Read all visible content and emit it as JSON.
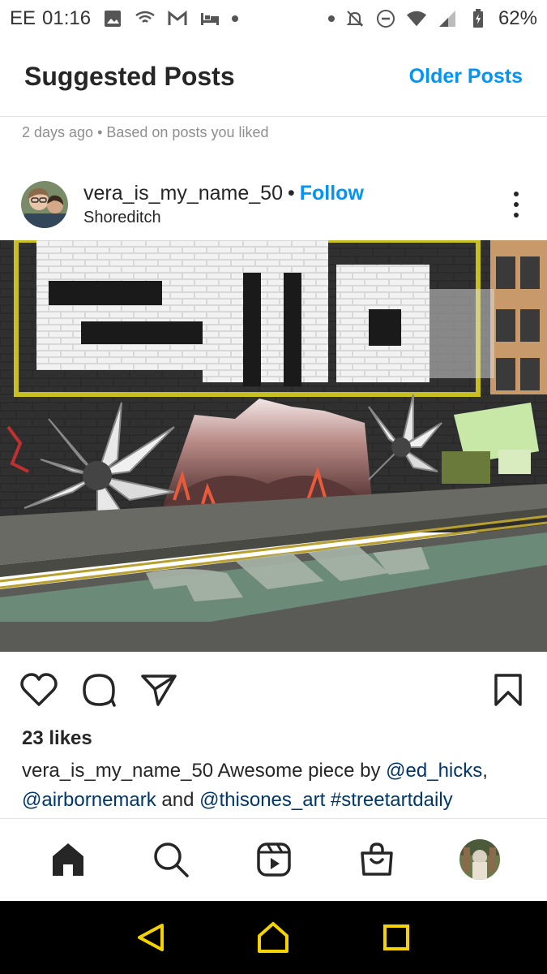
{
  "status_bar": {
    "carrier": "EE",
    "time": "01:16",
    "battery_percent": "62%",
    "left_icons": [
      "image-icon",
      "cast-icon",
      "gmail-icon",
      "bed-icon"
    ],
    "right_icons": [
      "mute-icon",
      "do-not-disturb-icon",
      "wifi-icon",
      "signal-icon",
      "battery-icon"
    ]
  },
  "header": {
    "title": "Suggested Posts",
    "older_link": "Older Posts"
  },
  "subline": "2 days ago • Based on posts you liked",
  "post": {
    "username": "vera_is_my_name_50",
    "separator": "•",
    "follow_label": "Follow",
    "location": "Shoreditch",
    "likes": "23 likes",
    "caption": {
      "user": "vera_is_my_name_50",
      "text1": "Awesome piece by",
      "mention1": "@ed_hicks",
      "comma": ",",
      "mention2": "@airbornemark",
      "text2": "and",
      "mention3": "@thisones_art",
      "hashtag": "#streetartdaily"
    }
  },
  "bottom_nav": [
    "home-icon",
    "search-icon",
    "reels-icon",
    "shop-icon",
    "profile-avatar"
  ],
  "system_nav": [
    "back-icon",
    "home-icon",
    "recents-icon"
  ],
  "colors": {
    "accent": "#0095f6",
    "mention": "#00376b",
    "text": "#262626",
    "muted": "#8e8e8e",
    "system_nav_icon": "#f5d300"
  }
}
